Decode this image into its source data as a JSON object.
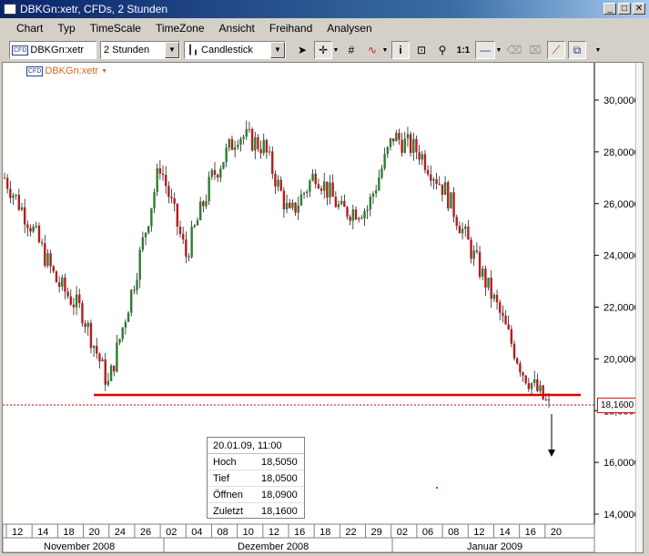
{
  "window": {
    "title": "DBKGn:xetr, CFDs, 2 Stunden",
    "buttons": [
      "_",
      "□",
      "✕"
    ]
  },
  "menu": [
    "Chart",
    "Typ",
    "TimeScale",
    "TimeZone",
    "Ansicht",
    "Freihand",
    "Analysen"
  ],
  "toolbar": {
    "symbol": "DBKGn:xetr",
    "symbol_badge": "CFD",
    "timeframe": "2 Stunden",
    "chart_type": "Candlestick",
    "ratio_label": "1:1"
  },
  "chart": {
    "instrument_label": "DBKGn:xetr",
    "current_price": "18,1600",
    "y_axis_ticks": [
      "30,0000",
      "28,0000",
      "26,0000",
      "24,0000",
      "22,0000",
      "20,0000",
      "18,0000",
      "16,0000",
      "14,0000"
    ],
    "x_day_ticks": [
      "12",
      "14",
      "18",
      "20",
      "24",
      "26",
      "02",
      "04",
      "08",
      "10",
      "12",
      "16",
      "18",
      "22",
      "29",
      "02",
      "06",
      "08",
      "12",
      "14",
      "16",
      "20"
    ],
    "x_month_ticks": [
      "November 2008",
      "Dezember 2008",
      "Januar 2009"
    ],
    "colors": {
      "bull": "#2e7d32",
      "bear": "#b71c1c",
      "support_line": "#dd0000",
      "price_line": "#cc0000"
    }
  },
  "info_box": {
    "header": "20.01.09, 11:00",
    "rows": [
      {
        "label": "Hoch",
        "value": "18,5050"
      },
      {
        "label": "Tief",
        "value": "18,0500"
      },
      {
        "label": "Öffnen",
        "value": "18,0900"
      },
      {
        "label": "Zuletzt",
        "value": "18,1600"
      }
    ]
  },
  "chart_data": {
    "type": "line",
    "title": "DBKGn:xetr",
    "ylim": [
      13.5,
      31
    ],
    "x": [
      "12",
      "14",
      "18",
      "20",
      "24",
      "26",
      "02",
      "04",
      "08",
      "10",
      "12",
      "16",
      "18",
      "22",
      "29",
      "02",
      "06",
      "08",
      "12",
      "14",
      "16",
      "20"
    ],
    "series": [
      {
        "name": "DBKGn:xetr",
        "values": [
          27.0,
          25.2,
          23.0,
          21.8,
          19.0,
          23.0,
          27.5,
          24.0,
          27.0,
          28.7,
          28.2,
          25.5,
          27.2,
          25.7,
          25.8,
          28.6,
          28.0,
          26.5,
          24.2,
          22.0,
          19.5,
          18.16
        ]
      }
    ],
    "support_level": 18.45,
    "last_price": 18.16
  }
}
